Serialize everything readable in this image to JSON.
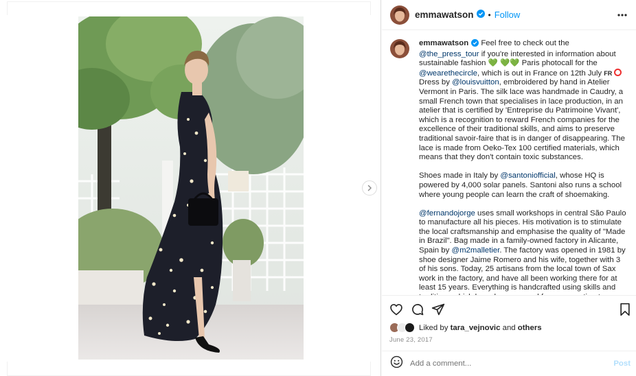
{
  "post": {
    "username": "emmawatson",
    "follow_label": "Follow",
    "separator": "•"
  },
  "caption": {
    "username": "emmawatson",
    "p1": {
      "t1": "Feel free to check out the ",
      "m1": "@the_press_tour",
      "t2": " if you're interested in information about sustainable fashion ",
      "hearts_a": "💚",
      "hearts_b": "💚💚",
      "t3": " Paris photocall for the ",
      "m2": "@wearethecircle",
      "t4": ", which is out in France on 12th July ",
      "flag": "FR",
      "t5": " Dress by ",
      "m3": "@louisvuitton",
      "t6": ", embroidered by hand in Atelier Vermont in Paris. The silk lace was handmade in Caudry, a small French town that specialises in lace production, in an atelier that is certified by 'Entreprise du Patrimoine Vivant', which is a recognition to reward French companies for the excellence of their traditional skills, and aims to preserve traditional savoir-faire that is in danger of disappearing. The lace is made from Oeko-Tex 100 certified materials, which means that they don't contain toxic substances."
    },
    "p2": {
      "t1": "Shoes made in Italy by ",
      "m1": "@santoniofficial",
      "t2": ", whose HQ is powered by 4,000 solar panels. Santoni also runs a school where young people can learn the craft of shoemaking."
    },
    "p3": {
      "m1": "@fernandojorge",
      "t1": " uses small workshops in central São Paulo to manufacture all his pieces. His motivation is to stimulate the local craftsmanship and emphasise the quality of \"Made in Brazil\". Bag made in a family-owned factory in Alicante, Spain by ",
      "m2": "@m2malletier",
      "t2": ". The factory was opened in 1981 by shoe designer Jaime Romero and his wife, together with 3 of his sons. Today, 25 artisans from the local town of Sax work in the factory, and have all been working there for at least 15 years. Everything is handcrafted using skills and traditions which have been passed from generation to generation."
    }
  },
  "likes": {
    "prefix": "Liked by",
    "user": "tara_vejnovic",
    "and": "and",
    "others": "others"
  },
  "date": "June 23, 2017",
  "comment": {
    "placeholder": "Add a comment...",
    "post_label": "Post"
  },
  "icons": {
    "verified": "verified-badge-icon",
    "more": "more-options-icon",
    "like": "heart-icon",
    "comment": "comment-icon",
    "share": "share-icon",
    "save": "bookmark-icon",
    "emoji": "emoji-icon",
    "next": "chevron-right-icon"
  },
  "colors": {
    "link_blue": "#0095f6",
    "mention": "#00376b",
    "muted": "#8e8e8e",
    "post_disabled": "#b2dffc"
  }
}
